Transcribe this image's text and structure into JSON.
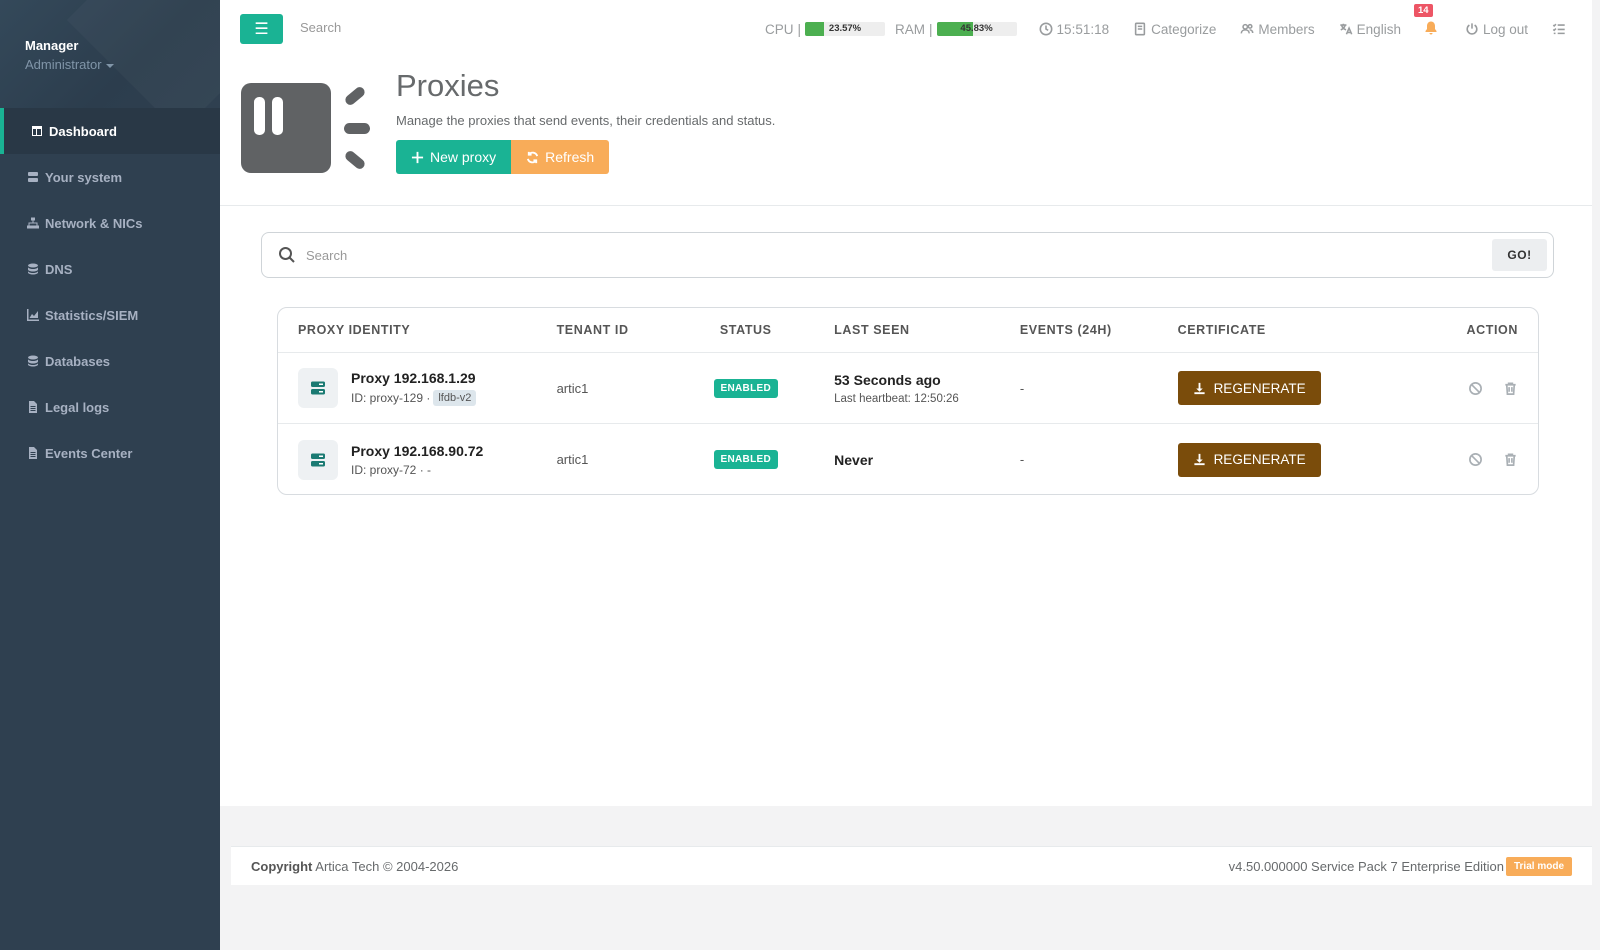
{
  "sidebar": {
    "profile": {
      "name": "Manager",
      "role": "Administrator"
    },
    "items": [
      {
        "label": "Dashboard",
        "icon": "table-icon",
        "active": true
      },
      {
        "label": "Your system",
        "icon": "server-icon"
      },
      {
        "label": "Network & NICs",
        "icon": "sitemap-icon"
      },
      {
        "label": "DNS",
        "icon": "database-icon"
      },
      {
        "label": "Statistics/SIEM",
        "icon": "chart-icon"
      },
      {
        "label": "Databases",
        "icon": "database-icon"
      },
      {
        "label": "Legal logs",
        "icon": "file-icon"
      },
      {
        "label": "Events Center",
        "icon": "file-icon"
      }
    ]
  },
  "topbar": {
    "search_placeholder": "Search",
    "cpu": {
      "label": "CPU",
      "sep": "|",
      "value": "23.57%",
      "percent": 23.57
    },
    "ram": {
      "label": "RAM",
      "sep": "|",
      "value": "45.83%",
      "percent": 45.83
    },
    "time": "15:51:18",
    "categorize": "Categorize",
    "members": "Members",
    "language": "English",
    "notifications": "14",
    "logout": "Log out"
  },
  "header": {
    "title": "Proxies",
    "subtitle": "Manage the proxies that send events, their credentials and status.",
    "new_button": "New proxy",
    "refresh_button": "Refresh"
  },
  "search": {
    "placeholder": "Search",
    "go": "GO!"
  },
  "table": {
    "columns": [
      "PROXY IDENTITY",
      "TENANT ID",
      "STATUS",
      "LAST SEEN",
      "EVENTS (24H)",
      "CERTIFICATE",
      "ACTION"
    ],
    "rows": [
      {
        "name": "Proxy 192.168.1.29",
        "id": "ID: proxy-129 ·",
        "tag": "lfdb-v2",
        "tenant": "artic1",
        "status": "ENABLED",
        "last_seen": "53 Seconds ago",
        "heartbeat": "Last heartbeat: 12:50:26",
        "events": "-",
        "cert": "REGENERATE"
      },
      {
        "name": "Proxy 192.168.90.72",
        "id": "ID: proxy-72 · -",
        "tag": "",
        "tenant": "artic1",
        "status": "ENABLED",
        "last_seen": "Never",
        "heartbeat": "",
        "events": "-",
        "cert": "REGENERATE"
      }
    ]
  },
  "footer": {
    "copyright_label": "Copyright",
    "copyright_text": "Artica Tech © 2004-2026",
    "version": "v4.50.000000 Service Pack 7 Enterprise Edition",
    "trial": "Trial mode"
  },
  "colors": {
    "accent": "#1ab394",
    "warning": "#f8ac59",
    "regen": "#7a4c0b",
    "sidebar": "#2f4050"
  }
}
